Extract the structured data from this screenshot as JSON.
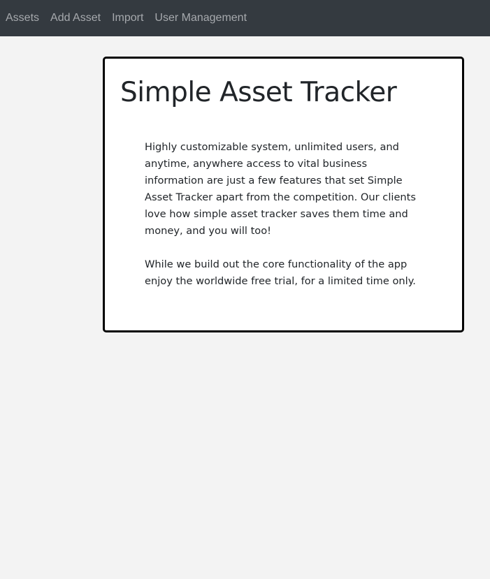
{
  "nav": {
    "items": [
      {
        "label": "Assets"
      },
      {
        "label": "Add Asset"
      },
      {
        "label": "Import"
      },
      {
        "label": "User Management"
      }
    ]
  },
  "main": {
    "title": "Simple Asset Tracker",
    "paragraphs": [
      "Highly customizable system, unlimited users, and anytime, anywhere access to vital business information are just a few features that set Simple Asset Tracker apart from the competition. Our clients love how simple asset tracker saves them time and money, and you will too!",
      "While we build out the core functionality of the app enjoy the worldwide free trial, for a limited time only."
    ]
  },
  "colors": {
    "navbar_bg": "#343a40",
    "nav_link": "#a6a9ad",
    "page_bg": "#f3f3f3",
    "card_border": "#000000",
    "text": "#212529"
  }
}
